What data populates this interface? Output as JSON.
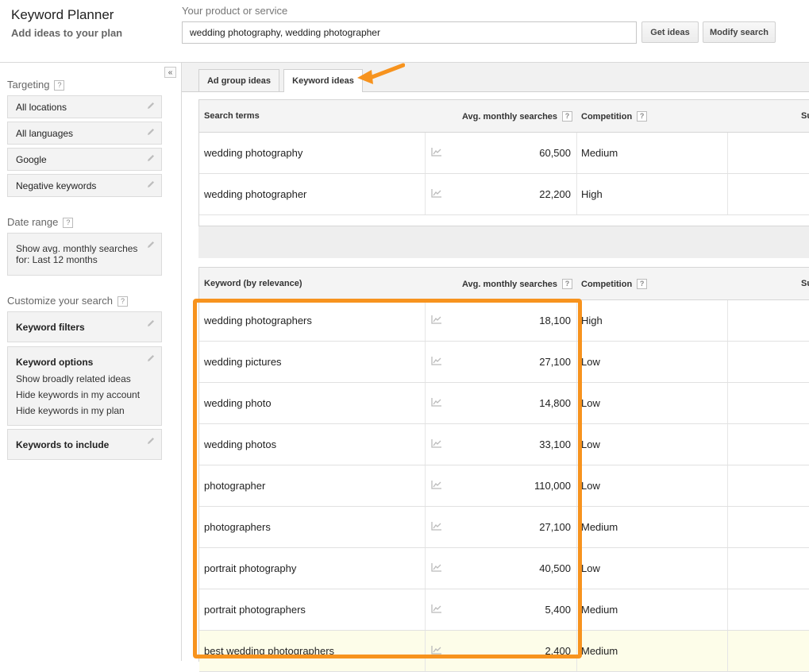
{
  "header": {
    "app_title": "Keyword Planner",
    "app_subtitle": "Add ideas to your plan",
    "product_label": "Your product or service",
    "product_value": "wedding photography, wedding photographer",
    "get_ideas_label": "Get ideas",
    "modify_search_label": "Modify search"
  },
  "sidebar": {
    "collapse_glyph": "«",
    "targeting_label": "Targeting",
    "targeting_items": [
      "All locations",
      "All languages",
      "Google",
      "Negative keywords"
    ],
    "date_range_label": "Date range",
    "date_range_line1": "Show avg. monthly searches",
    "date_range_line2": "for: Last 12 months",
    "customize_label": "Customize your search",
    "keyword_filters_label": "Keyword filters",
    "keyword_options_label": "Keyword options",
    "keyword_options_items": [
      "Show broadly related ideas",
      "Hide keywords in my account",
      "Hide keywords in my plan"
    ],
    "keywords_include_label": "Keywords to include",
    "help_glyph": "?"
  },
  "tabs": {
    "ad_group_ideas": "Ad group ideas",
    "keyword_ideas": "Keyword ideas"
  },
  "search_terms_table": {
    "col_term": "Search terms",
    "col_searches": "Avg. monthly searches",
    "col_competition": "Competition",
    "col_truncated": "Su",
    "rows": [
      {
        "keyword": "wedding photography",
        "searches": "60,500",
        "competition": "Medium"
      },
      {
        "keyword": "wedding photographer",
        "searches": "22,200",
        "competition": "High"
      }
    ]
  },
  "keyword_table": {
    "col_keyword": "Keyword (by relevance)",
    "col_searches": "Avg. monthly searches",
    "col_competition": "Competition",
    "col_truncated": "Su",
    "rows": [
      {
        "keyword": "wedding photographers",
        "searches": "18,100",
        "competition": "High"
      },
      {
        "keyword": "wedding pictures",
        "searches": "27,100",
        "competition": "Low"
      },
      {
        "keyword": "wedding photo",
        "searches": "14,800",
        "competition": "Low"
      },
      {
        "keyword": "wedding photos",
        "searches": "33,100",
        "competition": "Low"
      },
      {
        "keyword": "photographer",
        "searches": "110,000",
        "competition": "Low"
      },
      {
        "keyword": "photographers",
        "searches": "27,100",
        "competition": "Medium"
      },
      {
        "keyword": "portrait photography",
        "searches": "40,500",
        "competition": "Low"
      },
      {
        "keyword": "portrait photographers",
        "searches": "5,400",
        "competition": "Medium"
      },
      {
        "keyword": "best wedding photographers",
        "searches": "2,400",
        "competition": "Medium"
      }
    ]
  },
  "annotation": {
    "accent_color": "#f7931e"
  },
  "icons": {
    "edit": "pencil-icon",
    "trend": "trend-chart-icon",
    "collapse": "collapse-left-icon"
  }
}
